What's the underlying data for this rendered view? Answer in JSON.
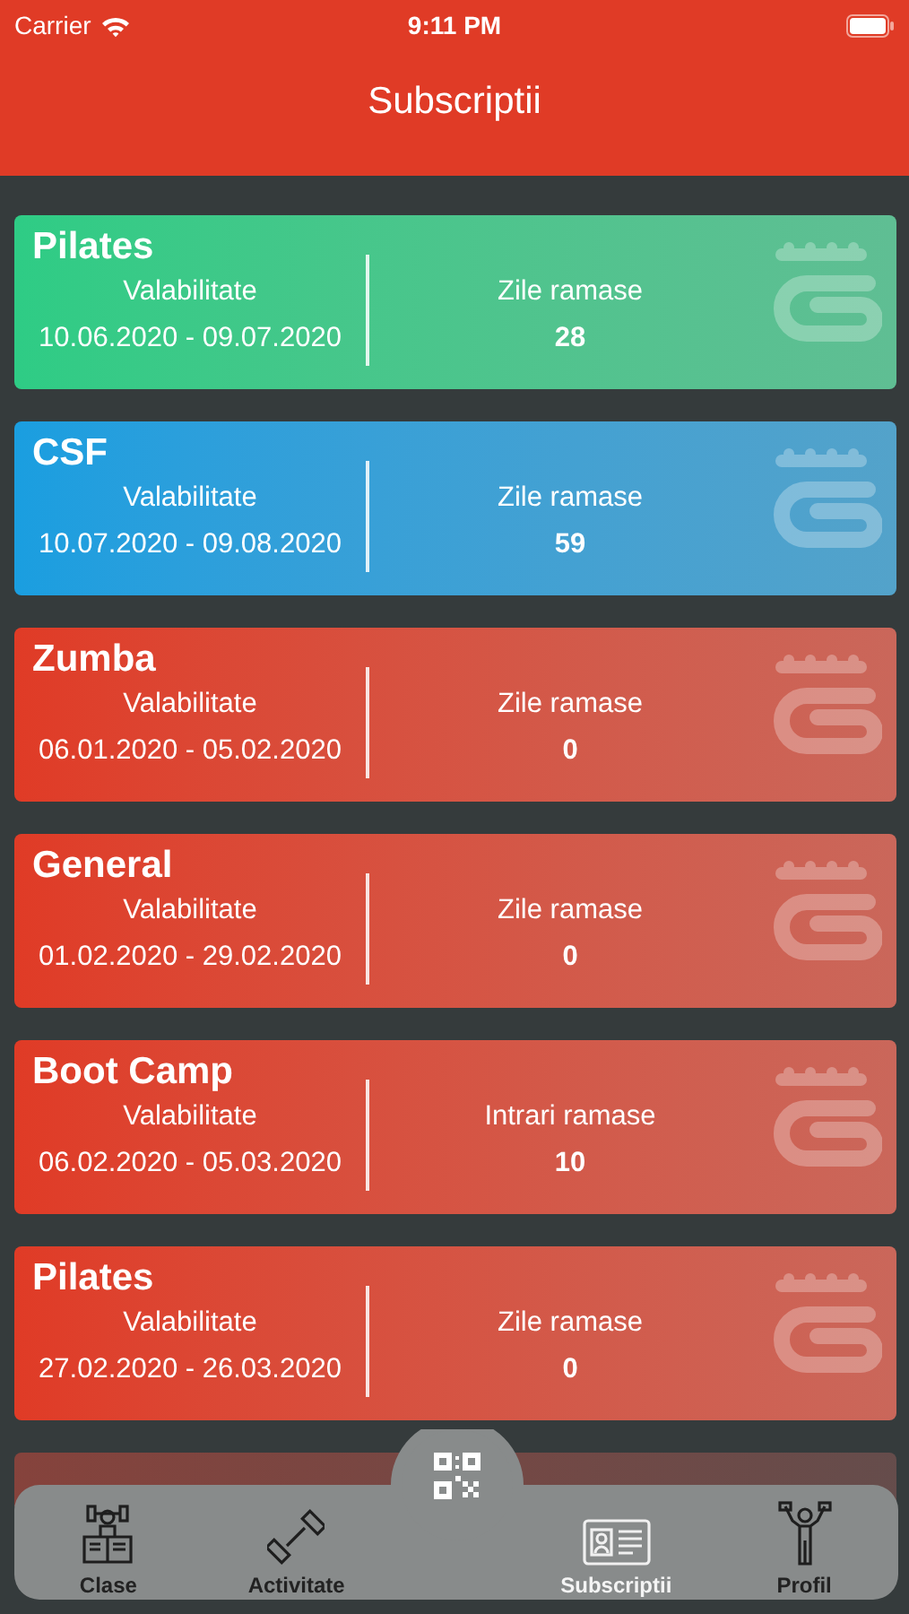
{
  "status_bar": {
    "carrier": "Carrier",
    "time": "9:11 PM"
  },
  "nav": {
    "title": "Subscriptii"
  },
  "subscriptions": [
    {
      "name": "Pilates",
      "color": "#2ecc85",
      "validity_label": "Valabilitate",
      "period": "10.06.2020 - 09.07.2020",
      "remaining_label": "Zile ramase",
      "remaining": "28"
    },
    {
      "name": "CSF",
      "color": "#1a9ee0",
      "validity_label": "Valabilitate",
      "period": "10.07.2020 - 09.08.2020",
      "remaining_label": "Zile ramase",
      "remaining": "59"
    },
    {
      "name": "Zumba",
      "color": "#e03b26",
      "validity_label": "Valabilitate",
      "period": "06.01.2020 - 05.02.2020",
      "remaining_label": "Zile ramase",
      "remaining": "0"
    },
    {
      "name": "General",
      "color": "#e03b26",
      "validity_label": "Valabilitate",
      "period": "01.02.2020 - 29.02.2020",
      "remaining_label": "Zile ramase",
      "remaining": "0"
    },
    {
      "name": "Boot Camp",
      "color": "#e03b26",
      "validity_label": "Valabilitate",
      "period": "06.02.2020 - 05.03.2020",
      "remaining_label": "Intrari ramase",
      "remaining": "10"
    },
    {
      "name": "Pilates",
      "color": "#e03b26",
      "validity_label": "Valabilitate",
      "period": "27.02.2020 - 26.03.2020",
      "remaining_label": "Zile ramase",
      "remaining": "0"
    }
  ],
  "tab_bar": [
    {
      "kind": "classes",
      "label": "Clase",
      "selected": false
    },
    {
      "kind": "activity",
      "label": "Activitate",
      "selected": false
    },
    {
      "kind": "scan",
      "selected": false
    },
    {
      "kind": "card",
      "label": "Subscriptii",
      "selected": true
    },
    {
      "kind": "profile",
      "label": "Profil",
      "selected": false
    }
  ]
}
